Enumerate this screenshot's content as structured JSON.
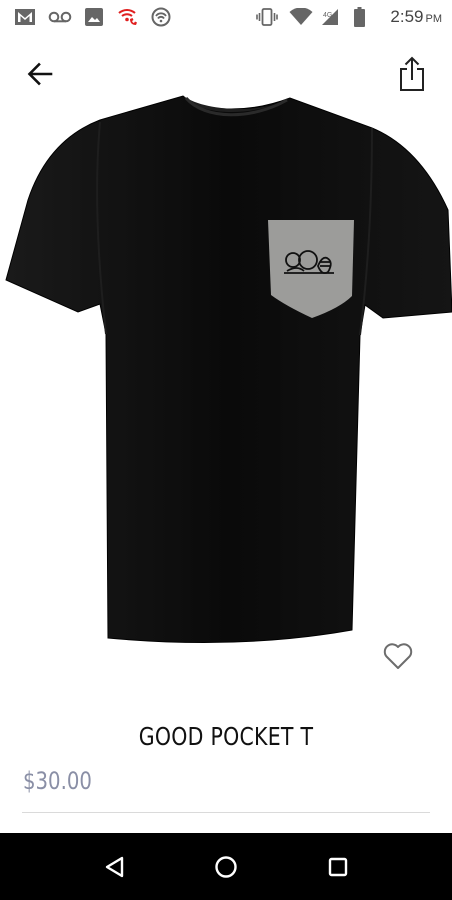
{
  "status_bar": {
    "time": "2:59",
    "ampm": "PM",
    "left_icons": [
      "gmail-icon",
      "voicemail-icon",
      "image-icon",
      "wifi-call-icon",
      "hotspot-icon"
    ],
    "right_icons": [
      "vibrate-icon",
      "wifi-icon",
      "signal-icon",
      "battery-icon"
    ]
  },
  "app_bar": {
    "back_icon": "arrow-left-icon",
    "share_icon": "share-icon"
  },
  "product": {
    "title": "GOOD POCKET T",
    "price": "$30.00",
    "favorite_icon": "heart-outline-icon",
    "image": {
      "subject": "black-t-shirt",
      "shirt_color": "#0c0c0c",
      "pocket_color": "#9c9c9a"
    }
  },
  "nav_bar": {
    "buttons": [
      "back-triangle-icon",
      "home-circle-icon",
      "recents-square-icon"
    ]
  },
  "colors": {
    "price": "#8a8fa6",
    "nav_background": "#000000",
    "background": "#ffffff"
  }
}
